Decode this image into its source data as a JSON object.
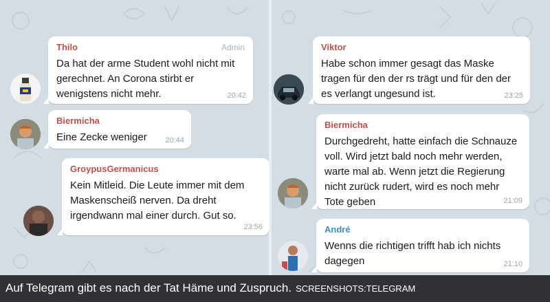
{
  "messages": [
    {
      "sender": "Thilo",
      "badge": "Admin",
      "text": "Da hat der arme Student wohl nicht mit gerechnet. An Corona stirbt er wenigstens nicht mehr.",
      "time": "20:42",
      "sender_color": "#c0504d"
    },
    {
      "sender": "Biermicha",
      "text": "Eine Zecke weniger",
      "time": "20:44",
      "sender_color": "#c0504d"
    },
    {
      "sender": "GroypusGermanicus",
      "text": "Kein Mitleid. Die Leute immer mit dem Maskenscheiß nerven. Da dreht irgendwann mal einer durch. Gut so.",
      "time": "23:56",
      "sender_color": "#c0504d"
    },
    {
      "sender": "Viktor",
      "text": "Habe schon immer gesagt das Maske tragen für den der rs trägt und für den der es verlangt ungesund ist.",
      "time": "23:25",
      "sender_color": "#c0504d"
    },
    {
      "sender": "Biermicha",
      "text": "Durchgedreht, hatte einfach die Schnauze voll. Wird jetzt bald noch mehr werden, warte mal ab. Wenn jetzt die Regierung nicht zurück rudert, wird es noch mehr Tote geben",
      "time": "21:09",
      "sender_color": "#c0504d"
    },
    {
      "sender": "André",
      "text": "Wenns die richtigen trifft hab ich nichts dagegen",
      "time": "21:10",
      "sender_color": "#3d8fbf"
    }
  ],
  "caption": {
    "text": "Auf Telegram gibt es nach der Tat Häme und Zuspruch.",
    "credit": "SCREENSHOTS:TELEGRAM"
  },
  "colors": {
    "chat_background": "#d4dde3",
    "bubble": "#ffffff",
    "caption_bar": "#303236"
  }
}
